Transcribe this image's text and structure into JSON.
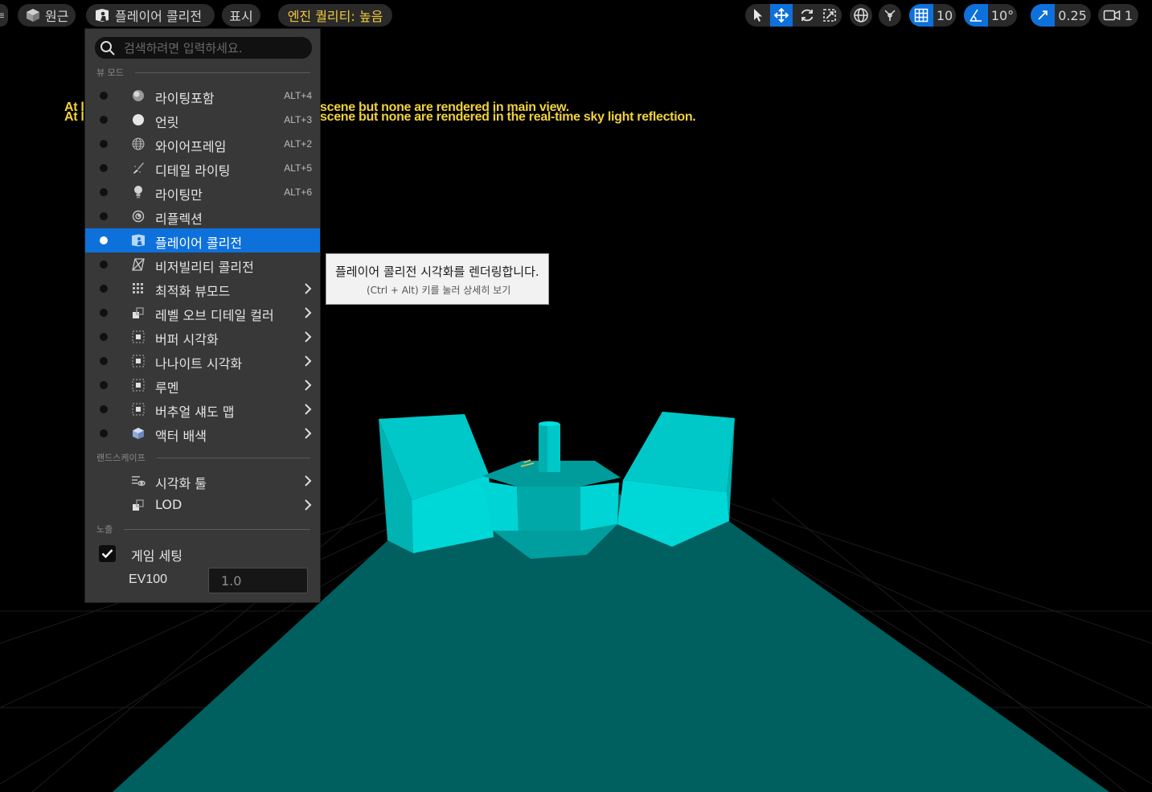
{
  "toolbar": {
    "perspective_label": "원근",
    "view_mode_label": "플레이어 콜리전",
    "show_label": "표시",
    "engine_quality_label": "엔진 퀄리티: 높음",
    "grid_snap_value": "10",
    "rotation_snap_value": "10°",
    "scale_snap_value": "0.25",
    "camera_speed_value": "1"
  },
  "viewport": {
    "warning_prefix_1": "At l",
    "warning_prefix_2": "At l",
    "warning_line_1": "scene but none are rendered in main view.",
    "warning_line_2": "scene but none are rendered in the real-time sky light reflection.",
    "floor_color": "#005f5f",
    "mesh_color": "#00d0d0"
  },
  "menu": {
    "search_placeholder": "검색하려면 입력하세요.",
    "section_view_mode": "뷰 모드",
    "section_landscape": "랜드스케이프",
    "section_exposure": "노출",
    "items": [
      {
        "label": "라이팅포함",
        "shortcut": "ALT+4"
      },
      {
        "label": "언릿",
        "shortcut": "ALT+3"
      },
      {
        "label": "와이어프레임",
        "shortcut": "ALT+2"
      },
      {
        "label": "디테일 라이팅",
        "shortcut": "ALT+5"
      },
      {
        "label": "라이팅만",
        "shortcut": "ALT+6"
      },
      {
        "label": "리플렉션",
        "shortcut": ""
      },
      {
        "label": "플레이어 콜리전",
        "shortcut": ""
      },
      {
        "label": "비저빌리티 콜리전",
        "shortcut": ""
      },
      {
        "label": "최적화 뷰모드",
        "shortcut": ""
      },
      {
        "label": "레벨 오브 디테일 컬러",
        "shortcut": ""
      },
      {
        "label": "버퍼 시각화",
        "shortcut": ""
      },
      {
        "label": "나나이트 시각화",
        "shortcut": ""
      },
      {
        "label": "루멘",
        "shortcut": ""
      },
      {
        "label": "버추얼 섀도 맵",
        "shortcut": ""
      },
      {
        "label": "액터 배색",
        "shortcut": ""
      }
    ],
    "landscape_items": [
      {
        "label": "시각화 툴"
      },
      {
        "label": "LOD"
      }
    ],
    "game_settings_label": "게임 세팅",
    "game_settings_checked": true,
    "ev100_label": "EV100",
    "ev100_value": "1.0",
    "accent_color": "#0e71db"
  },
  "tooltip": {
    "title": "플레이어 콜리전 시각화를 렌더링합니다.",
    "hint": "(Ctrl + Alt) 키를 눌러 상세히 보기"
  }
}
